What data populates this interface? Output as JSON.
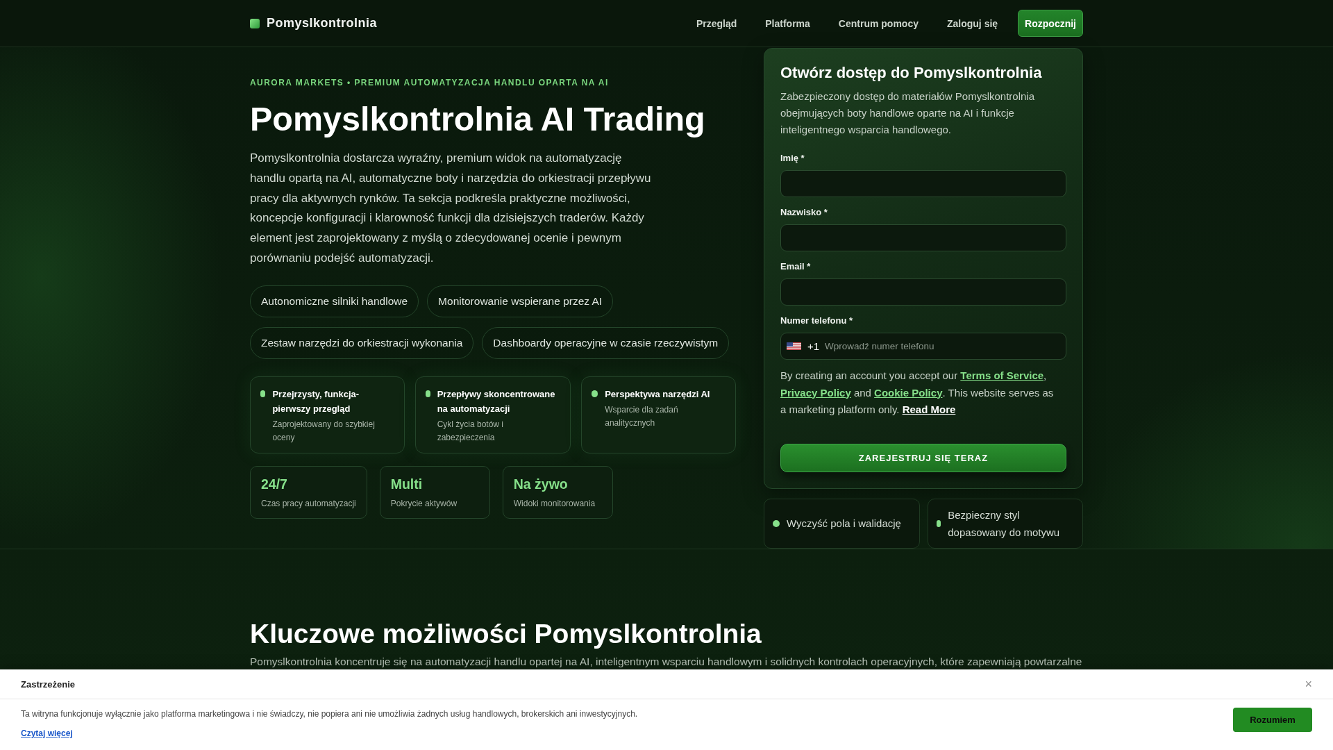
{
  "header": {
    "logo": "Pomyslkontrolnia",
    "nav": [
      {
        "label": "Przegląd"
      },
      {
        "label": "Platforma"
      },
      {
        "label": "Centrum pomocy"
      },
      {
        "label": "Zaloguj się"
      }
    ],
    "cta": "Rozpocznij"
  },
  "hero": {
    "eyebrow": "AURORA MARKETS • PREMIUM AUTOMATYZACJA HANDLU OPARTA NA AI",
    "title": "Pomyslkontrolnia AI Trading",
    "description": "Pomyslkontrolnia dostarcza wyraźny, premium widok na automatyzację handlu opartą na AI, automatyczne boty i narzędzia do orkiestracji przepływu pracy dla aktywnych rynków. Ta sekcja podkreśla praktyczne możliwości, koncepcje konfiguracji i klarowność funkcji dla dzisiejszych traderów. Każdy element jest zaprojektowany z myślą o zdecydowanej ocenie i pewnym porównaniu podejść automatyzacji.",
    "tags": [
      "Autonomiczne silniki handlowe",
      "Monitorowanie wspierane przez AI",
      "Zestaw narzędzi do orkiestracji wykonania",
      "Dashboardy operacyjne w czasie rzeczywistym"
    ],
    "features": [
      {
        "title": "Przejrzysty, funkcja-pierwszy przegląd",
        "subtitle": "Zaprojektowany do szybkiej oceny"
      },
      {
        "title": "Przepływy skoncentrowane na automatyzacji",
        "subtitle": "Cykl życia botów i zabezpieczenia"
      },
      {
        "title": "Perspektywa narzędzi AI",
        "subtitle": "Wsparcie dla zadań analitycznych"
      }
    ],
    "stats": [
      {
        "value": "24/7",
        "label": "Czas pracy automatyzacji"
      },
      {
        "value": "Multi",
        "label": "Pokrycie aktywów"
      },
      {
        "value": "Na żywo",
        "label": "Widoki monitorowania"
      }
    ]
  },
  "signup_form": {
    "title": "Otwórz dostęp do Pomyslkontrolnia",
    "description": "Zabezpieczony dostęp do materiałów Pomyslkontrolnia obejmujących boty handlowe oparte na AI i funkcje inteligentnego wsparcia handlowego.",
    "fields": [
      {
        "kind": "text",
        "label": "Imię *"
      },
      {
        "kind": "text",
        "label": "Nazwisko *"
      },
      {
        "kind": "text",
        "label": "Email *"
      },
      {
        "kind": "phone",
        "label": "Numer telefonu *",
        "country_code": "+1",
        "placeholder": "Wprowadź numer telefonu"
      }
    ],
    "consent": [
      {
        "kind": "text",
        "text": "By creating an account you accept our "
      },
      {
        "kind": "policy_link",
        "text": "Terms of Service"
      },
      {
        "kind": "text",
        "text": ", "
      },
      {
        "kind": "policy_link",
        "text": "Privacy Policy"
      },
      {
        "kind": "text",
        "text": " and "
      },
      {
        "kind": "policy_link",
        "text": "Cookie Policy"
      },
      {
        "kind": "text",
        "text": ". This website serves as a marketing platform only. "
      },
      {
        "kind": "more_link",
        "text": "Read More"
      }
    ],
    "submit": "ZAREJESTRUJ SIĘ TERAZ"
  },
  "form_notes": [
    "Wyczyść pola i walidację",
    "Bezpieczny styl dopasowany do motywu"
  ],
  "capabilities": {
    "title": "Kluczowe możliwości Pomyslkontrolnia",
    "description": "Pomyslkontrolnia koncentruje się na automatyzacji handlu opartej na AI, inteligentnym wsparciu handlowym i solidnych kontrolach operacyjnych, które zapewniają powtarzalne"
  },
  "disclaimer_banner": {
    "title": "Zastrzeżenie",
    "close": "×",
    "text": "Ta witryna funkcjonuje wyłącznie jako platforma marketingowa i nie świadczy, nie popiera ani nie umożliwia żadnych usług handlowych, brokerskich ani inwestycyjnych.",
    "link": "Czytaj więcej",
    "button": "Rozumiem"
  }
}
